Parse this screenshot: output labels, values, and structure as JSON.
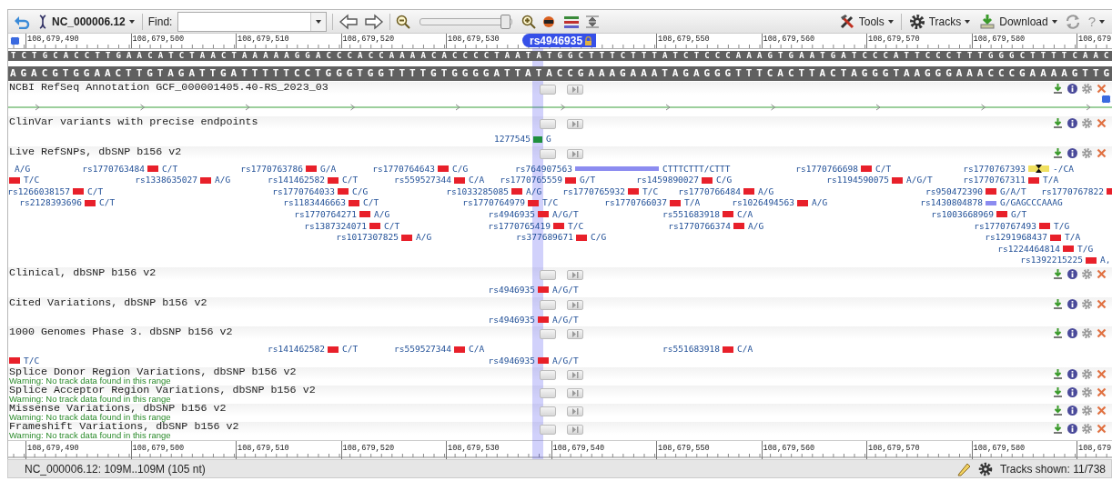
{
  "toolbar": {
    "sequence": "NC_000006.12",
    "find_label": "Find:",
    "zoom": {
      "level": 0.93
    },
    "menus": [
      {
        "label": "Tools"
      },
      {
        "label": "Tracks"
      },
      {
        "label": "Download"
      }
    ],
    "help": "?"
  },
  "ruler_top": {
    "labels": [
      "108,679,490",
      "108,679,500",
      "108,679,510",
      "108,679,520",
      "108,679,530",
      "108,679,550",
      "108,679,560",
      "108,679,570",
      "108,679,580",
      "108,679"
    ],
    "marker": "rs4946935"
  },
  "sequence": {
    "forward": "TCTGCACCTTGAACATCTAACTAAAAAGGACCCACCAAAACACCCCTAATATGGCTTTCTTTATCTCCCAAAGTGAATGATCCCATTCCCTTTGGGCTTTTCAAC",
    "reverse": "AGACGTGGAACTTGTAGATTGATTTTTCCTGGGTGGTTTTGTGGGGATTATACCGAAAGAAATAGAGGGTTTCACTTACTAGGGTAAGGGAAACCCGAAAAGTTG"
  },
  "tracks": [
    {
      "kind": "gene",
      "title": "NCBI RefSeq Annotation GCF_000001405.40-RS_2023_03"
    },
    {
      "kind": "variants",
      "title": "ClinVar variants with precise endpoints",
      "features": [
        {
          "name": "1277545",
          "allele": "G",
          "color": "#1f8f3f",
          "kind": "snv"
        }
      ]
    },
    {
      "kind": "variants",
      "title": "Live RefSNPs, dbSNP b156 v2",
      "features": [
        {
          "allele": "A/G"
        },
        {
          "name": "rs1770763484",
          "allele": "C/T",
          "color": "#e8202a",
          "kind": "snv"
        },
        {
          "name": "rs1770763786",
          "allele": "G/A",
          "color": "#e8202a",
          "kind": "snv"
        },
        {
          "name": "rs1770764643",
          "allele": "C/G",
          "color": "#e8202a",
          "kind": "snv"
        },
        {
          "name": "rs764907563",
          "allele": "CTTTCTTT/CTTT",
          "color": "#8c8cf0",
          "kind": "indel"
        },
        {
          "name": "rs1770766698",
          "allele": "C/T",
          "color": "#e8202a",
          "kind": "snv"
        },
        {
          "name": "rs1770767393",
          "allele": "-/CA",
          "color": "#f0e060",
          "kind": "insertion"
        },
        {
          "allele": "T/C",
          "color": "#e8202a",
          "kind": "snv"
        },
        {
          "name": "rs1338635027",
          "allele": "A/G",
          "color": "#e8202a",
          "kind": "snv"
        },
        {
          "name": "rs141462582",
          "allele": "C/T",
          "color": "#e8202a",
          "kind": "snv"
        },
        {
          "name": "rs559527344",
          "allele": "C/A",
          "color": "#e8202a",
          "kind": "snv"
        },
        {
          "name": "rs1770765559",
          "allele": "G/T",
          "color": "#e8202a",
          "kind": "snv"
        },
        {
          "name": "rs1459890027",
          "allele": "C/G",
          "color": "#e8202a",
          "kind": "snv"
        },
        {
          "name": "rs1194590075",
          "allele": "A/G/T",
          "color": "#e8202a",
          "kind": "snv"
        },
        {
          "name": "rs1770767311",
          "allele": "T/A",
          "color": "#e8202a",
          "kind": "snv"
        },
        {
          "name": "rs1266038157",
          "allele": "C/T",
          "color": "#e8202a",
          "kind": "snv"
        },
        {
          "name": "rs1770764033",
          "allele": "C/G",
          "color": "#e8202a",
          "kind": "snv"
        },
        {
          "name": "rs1033285085",
          "allele": "A/G",
          "color": "#e8202a",
          "kind": "snv"
        },
        {
          "name": "rs1770765932",
          "allele": "T/C",
          "color": "#e8202a",
          "kind": "snv"
        },
        {
          "name": "rs1770766484",
          "allele": "A/G",
          "color": "#e8202a",
          "kind": "snv"
        },
        {
          "name": "rs950472390",
          "allele": "G/A/T",
          "color": "#e8202a",
          "kind": "snv"
        },
        {
          "name": "rs1770767822",
          "color": "#e8202a",
          "kind": "snv"
        },
        {
          "name": "rs2128393696",
          "allele": "C/T",
          "color": "#e8202a",
          "kind": "snv"
        },
        {
          "name": "rs1183446663",
          "allele": "C/T",
          "color": "#e8202a",
          "kind": "snv"
        },
        {
          "name": "rs1770764979",
          "allele": "T/C",
          "color": "#e8202a",
          "kind": "snv"
        },
        {
          "name": "rs1770766037",
          "allele": "T/A",
          "color": "#e8202a",
          "kind": "snv"
        },
        {
          "name": "rs1026494563",
          "allele": "A/G",
          "color": "#e8202a",
          "kind": "snv"
        },
        {
          "name": "rs1430804878",
          "allele": "G/GAGCCCAAAG",
          "color": "#8c8cf0",
          "kind": "indel"
        },
        {
          "name": "rs1770764271",
          "allele": "A/G",
          "color": "#e8202a",
          "kind": "snv"
        },
        {
          "name": "rs4946935",
          "allele": "A/G/T",
          "color": "#e8202a",
          "kind": "snv"
        },
        {
          "name": "rs551683918",
          "allele": "C/A",
          "color": "#e8202a",
          "kind": "snv"
        },
        {
          "name": "rs1003668969",
          "allele": "G/T",
          "color": "#e8202a",
          "kind": "snv"
        },
        {
          "name": "rs1387324071",
          "allele": "C/T",
          "color": "#e8202a",
          "kind": "snv"
        },
        {
          "name": "rs1770765419",
          "allele": "T/C",
          "color": "#e8202a",
          "kind": "snv"
        },
        {
          "name": "rs1770766374",
          "allele": "A/G",
          "color": "#e8202a",
          "kind": "snv"
        },
        {
          "name": "rs1770767493",
          "allele": "T/G",
          "color": "#e8202a",
          "kind": "snv"
        },
        {
          "name": "rs1017307825",
          "allele": "A/G",
          "color": "#e8202a",
          "kind": "snv"
        },
        {
          "name": "rs377689671",
          "allele": "C/G",
          "color": "#e8202a",
          "kind": "snv"
        },
        {
          "name": "rs1291968437",
          "allele": "T/A",
          "color": "#e8202a",
          "kind": "snv"
        },
        {
          "name": "rs1224464814",
          "allele": "T/G",
          "color": "#e8202a",
          "kind": "snv"
        },
        {
          "name": "rs1392215225",
          "allele": "A,",
          "color": "#e8202a",
          "kind": "snv"
        }
      ]
    },
    {
      "kind": "variants",
      "title": "Clinical, dbSNP b156 v2",
      "features": [
        {
          "name": "rs4946935",
          "allele": "A/G/T",
          "color": "#e8202a",
          "kind": "snv"
        }
      ]
    },
    {
      "kind": "variants",
      "title": "Cited Variations, dbSNP b156 v2",
      "features": [
        {
          "name": "rs4946935",
          "allele": "A/G/T",
          "color": "#e8202a",
          "kind": "snv"
        }
      ]
    },
    {
      "kind": "variants",
      "title": "1000 Genomes Phase 3. dbSNP b156 v2",
      "features": [
        {
          "name": "rs141462582",
          "allele": "C/T",
          "color": "#e8202a",
          "kind": "snv"
        },
        {
          "name": "rs559527344",
          "allele": "C/A",
          "color": "#e8202a",
          "kind": "snv"
        },
        {
          "name": "rs551683918",
          "allele": "C/A",
          "color": "#e8202a",
          "kind": "snv"
        },
        {
          "allele": "T/C",
          "color": "#e8202a",
          "kind": "snv"
        },
        {
          "name": "rs4946935",
          "allele": "A/G/T",
          "color": "#e8202a",
          "kind": "snv"
        }
      ]
    },
    {
      "kind": "empty",
      "title": "Splice Donor Region Variations, dbSNP b156 v2",
      "warning": "Warning: No track data found in this range"
    },
    {
      "kind": "empty",
      "title": "Splice Acceptor Region Variations, dbSNP b156 v2",
      "warning": "Warning: No track data found in this range"
    },
    {
      "kind": "empty",
      "title": "Missense Variations, dbSNP b156 v2",
      "warning": "Warning: No track data found in this range"
    },
    {
      "kind": "empty",
      "title": "Frameshift Variations, dbSNP b156 v2",
      "warning": "Warning: No track data found in this range"
    }
  ],
  "ruler_bottom": {
    "labels": [
      "108,679,490",
      "108,679,500",
      "108,679,510",
      "108,679,520",
      "108,679,530",
      "108,679,540",
      "108,679,550",
      "108,679,560",
      "108,679,570",
      "108,679,580",
      "108,679"
    ]
  },
  "status_bar": {
    "location": "NC_000006.12: 109M..109M (105 nt)",
    "tracks_shown": "Tracks shown: 11/738"
  }
}
